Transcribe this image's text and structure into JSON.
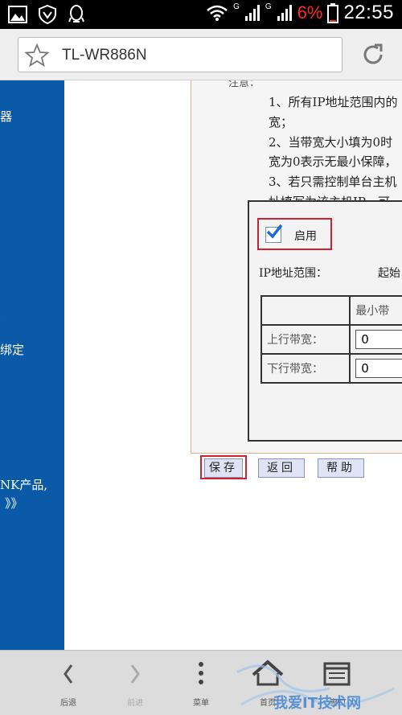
{
  "status_bar": {
    "time": "22:55",
    "battery_percent": "6%",
    "network_a": "G",
    "network_b": "G",
    "icons": [
      "gallery-icon",
      "shield-icon",
      "qq-icon",
      "wifi-icon",
      "signal-icon",
      "battery-icon"
    ]
  },
  "browser": {
    "url_title": "TL-WR886N",
    "bookmark_icon": "star-icon",
    "reload_icon": "reload-icon"
  },
  "sidebar": {
    "items": [
      "器",
      "》",
      "绑定",
      "NK产品,",
      "》》"
    ]
  },
  "notes": {
    "heading": "注意：",
    "lines": [
      "1、所有IP地址范围内的",
      "宽；",
      "2、当带宽大小填为0时",
      "宽为0表示无最小保障，",
      "3、若只需控制单台主机",
      "址填写为该主机IP，可"
    ]
  },
  "form": {
    "enable_label": "启用",
    "enable_checked": true,
    "ip_range_label": "IP地址范围：",
    "start_label": "起始",
    "table": {
      "header": [
        "",
        "最小带"
      ],
      "rows": [
        {
          "label": "上行带宽：",
          "value": "0"
        },
        {
          "label": "下行带宽：",
          "value": "0"
        }
      ]
    }
  },
  "buttons": {
    "save": "保存",
    "back": "返回",
    "help": "帮助"
  },
  "bottom_bar": {
    "items": [
      {
        "label": "后退",
        "icon": "back-icon"
      },
      {
        "label": "前进",
        "icon": "forward-icon"
      },
      {
        "label": "菜单",
        "icon": "menu-icon"
      },
      {
        "label": "首页",
        "icon": "home-icon"
      },
      {
        "label": "窗口",
        "icon": "tabs-icon"
      }
    ]
  },
  "watermark": "我爱IT技术网"
}
